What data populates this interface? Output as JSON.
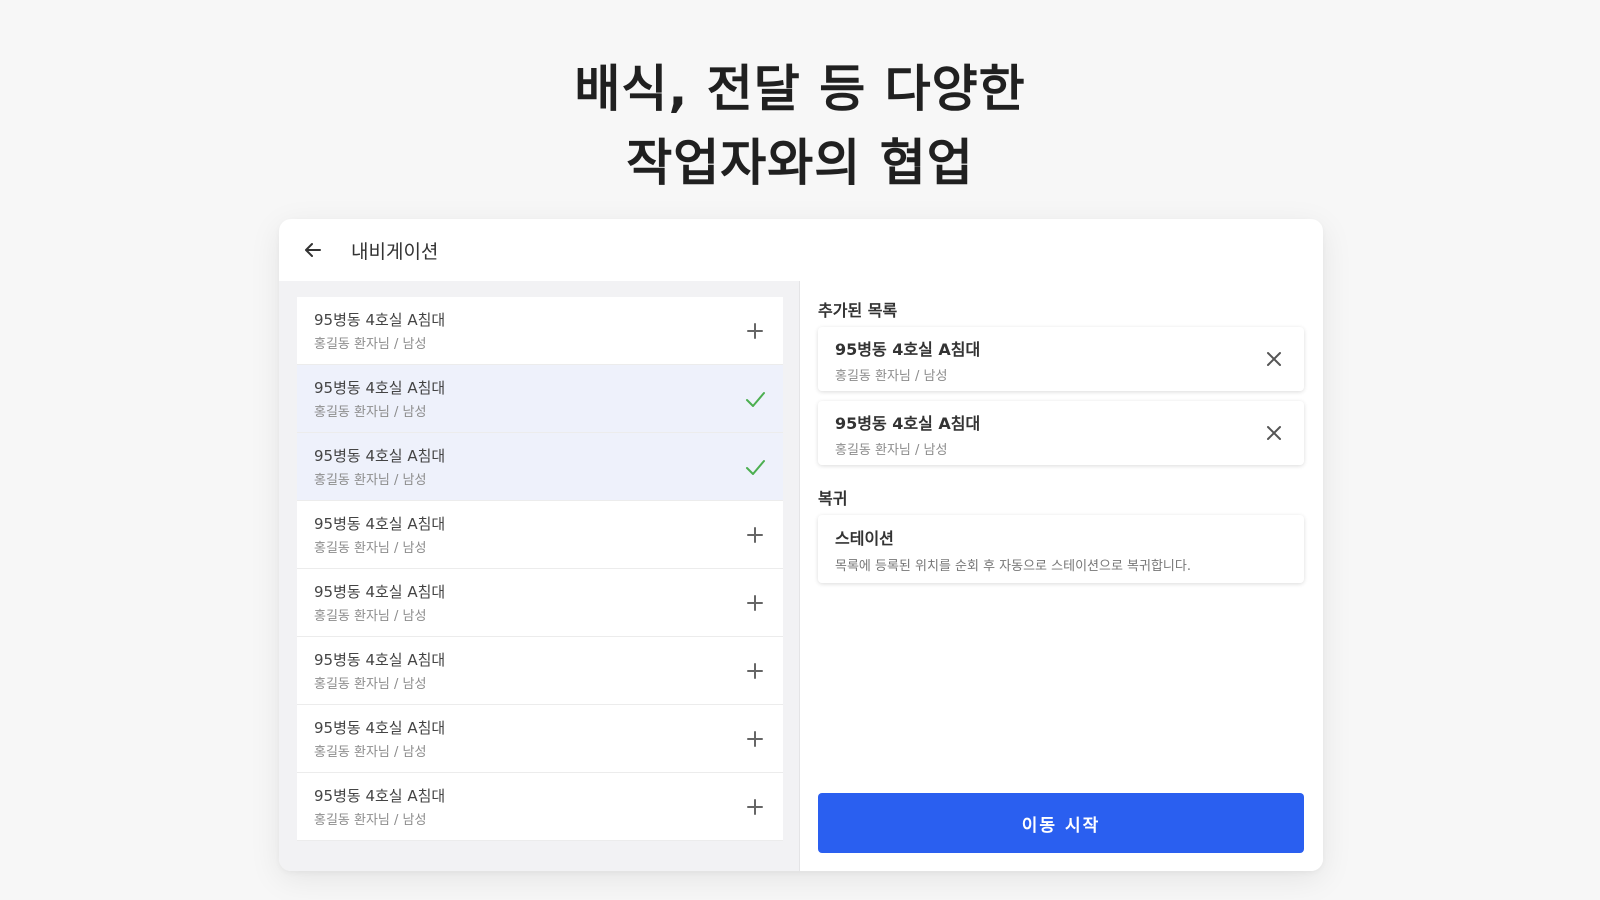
{
  "headline": {
    "line1": "배식, 전달 등 다양한",
    "line2": "작업자와의 협업"
  },
  "header": {
    "back_icon": "arrow-left-icon",
    "title": "내비게이션"
  },
  "left_list": {
    "items": [
      {
        "title": "95병동 4호실 A침대",
        "subtitle": "홍길동 환자님 / 남성",
        "state": "add"
      },
      {
        "title": "95병동 4호실 A침대",
        "subtitle": "홍길동 환자님 / 남성",
        "state": "selected"
      },
      {
        "title": "95병동 4호실 A침대",
        "subtitle": "홍길동 환자님 / 남성",
        "state": "selected"
      },
      {
        "title": "95병동 4호실 A침대",
        "subtitle": "홍길동 환자님 / 남성",
        "state": "add"
      },
      {
        "title": "95병동 4호실 A침대",
        "subtitle": "홍길동 환자님 / 남성",
        "state": "add"
      },
      {
        "title": "95병동 4호실 A침대",
        "subtitle": "홍길동 환자님 / 남성",
        "state": "add"
      },
      {
        "title": "95병동 4호실 A침대",
        "subtitle": "홍길동 환자님 / 남성",
        "state": "add"
      },
      {
        "title": "95병동 4호실 A침대",
        "subtitle": "홍길동 환자님 / 남성",
        "state": "add"
      }
    ]
  },
  "added_section": {
    "label": "추가된 목록",
    "items": [
      {
        "title": "95병동 4호실 A침대",
        "subtitle": "홍길동 환자님 / 남성"
      },
      {
        "title": "95병동 4호실 A침대",
        "subtitle": "홍길동 환자님 / 남성"
      }
    ]
  },
  "return_section": {
    "label": "복귀",
    "station_title": "스테이션",
    "station_desc": "목록에 등록된 위치를 순회 후 자동으로 스테이션으로 복귀합니다."
  },
  "start_button": {
    "label": "이동 시작"
  },
  "colors": {
    "accent": "#2a5ff0",
    "check": "#4caf50",
    "selected_bg": "#eef1fb"
  }
}
